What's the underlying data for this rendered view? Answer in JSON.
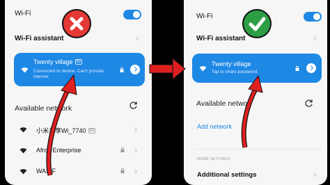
{
  "colors": {
    "accent": "#1e88e5",
    "error": "#e53935",
    "success": "#2e9e45",
    "arrow": "#e02020"
  },
  "left_screen": {
    "wifi_label": "Wi-Fi",
    "wifi_assistant": "Wi-Fi assistant",
    "connected_network": {
      "name": "Twenty village",
      "badge": "5G",
      "status": "Connected to device. Can't provide internet"
    },
    "available_networks_label": "Available network",
    "networks": [
      {
        "name": "小米共享Wi_7740",
        "badge": "5G"
      },
      {
        "name": "Afroz Enterprise"
      },
      {
        "name": "WASIF"
      }
    ]
  },
  "right_screen": {
    "wifi_label": "Wi-Fi",
    "wifi_assistant": "Wi-Fi assistant",
    "connected_network": {
      "name": "Twenty village",
      "status": "Tap to share password"
    },
    "available_networks_label": "Available netwo",
    "add_network": "Add network",
    "more_settings": "MORE SETTINGS",
    "additional_settings": "Additional settings"
  },
  "icons": {
    "status_error": "cross-icon",
    "status_ok": "checkmark-icon",
    "chevron": "chevron-right-icon",
    "refresh": "refresh-icon",
    "wifi": "wifi-icon",
    "lock": "lock-icon"
  }
}
